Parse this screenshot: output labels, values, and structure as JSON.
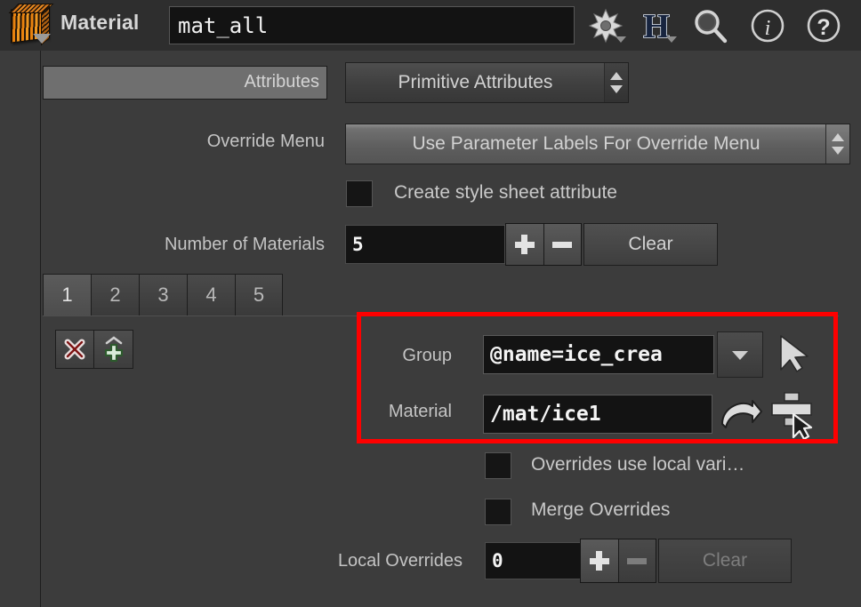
{
  "header": {
    "node_icon": "material-node-icon",
    "node_label": "Material",
    "node_name_value": "mat_all",
    "icons": [
      {
        "name": "gear-icon",
        "label": "gear"
      },
      {
        "name": "houdini-logo-icon",
        "label": "H"
      },
      {
        "name": "search-icon",
        "label": "search"
      },
      {
        "name": "info-icon",
        "label": "i"
      },
      {
        "name": "help-icon",
        "label": "?"
      }
    ]
  },
  "params": {
    "attributes_label": "Attributes",
    "attributes_value": "Primitive Attributes",
    "override_menu_label": "Override Menu",
    "override_menu_value": "Use Parameter Labels For Override Menu",
    "create_style_sheet_label": "Create style sheet attribute",
    "create_style_sheet_checked": false,
    "number_of_materials_label": "Number of Materials",
    "number_of_materials_value": "5",
    "clear_label": "Clear",
    "plus_label": "+",
    "minus_label": "-"
  },
  "tabs": {
    "items": [
      "1",
      "2",
      "3",
      "4",
      "5"
    ],
    "active_index": 0,
    "delete_icon": "delete-x-icon",
    "add_icon": "add-plus-icon"
  },
  "material_entry": {
    "group_label": "Group",
    "group_value": "@name=ice_crea",
    "group_dropdown_icon": "chevron-down-icon",
    "group_pick_icon": "cursor-arrow-icon",
    "material_label": "Material",
    "material_value": "/mat/ice1",
    "material_jump_icon": "goto-arrow-icon",
    "material_pick_icon": "node-picker-icon",
    "highlight_color": "#fe0000"
  },
  "overrides": {
    "local_vars_label": "Overrides use local vari…",
    "local_vars_checked": false,
    "merge_label": "Merge Overrides",
    "merge_checked": false,
    "local_overrides_label": "Local Overrides",
    "local_overrides_value": "0",
    "clear_label": "Clear",
    "clear_disabled": true
  },
  "colors": {
    "background": "#3c3c3c",
    "header_bg": "#2e2e2e",
    "field_bg": "#131313",
    "text": "#c8c8c8",
    "highlight": "#fe0000"
  }
}
